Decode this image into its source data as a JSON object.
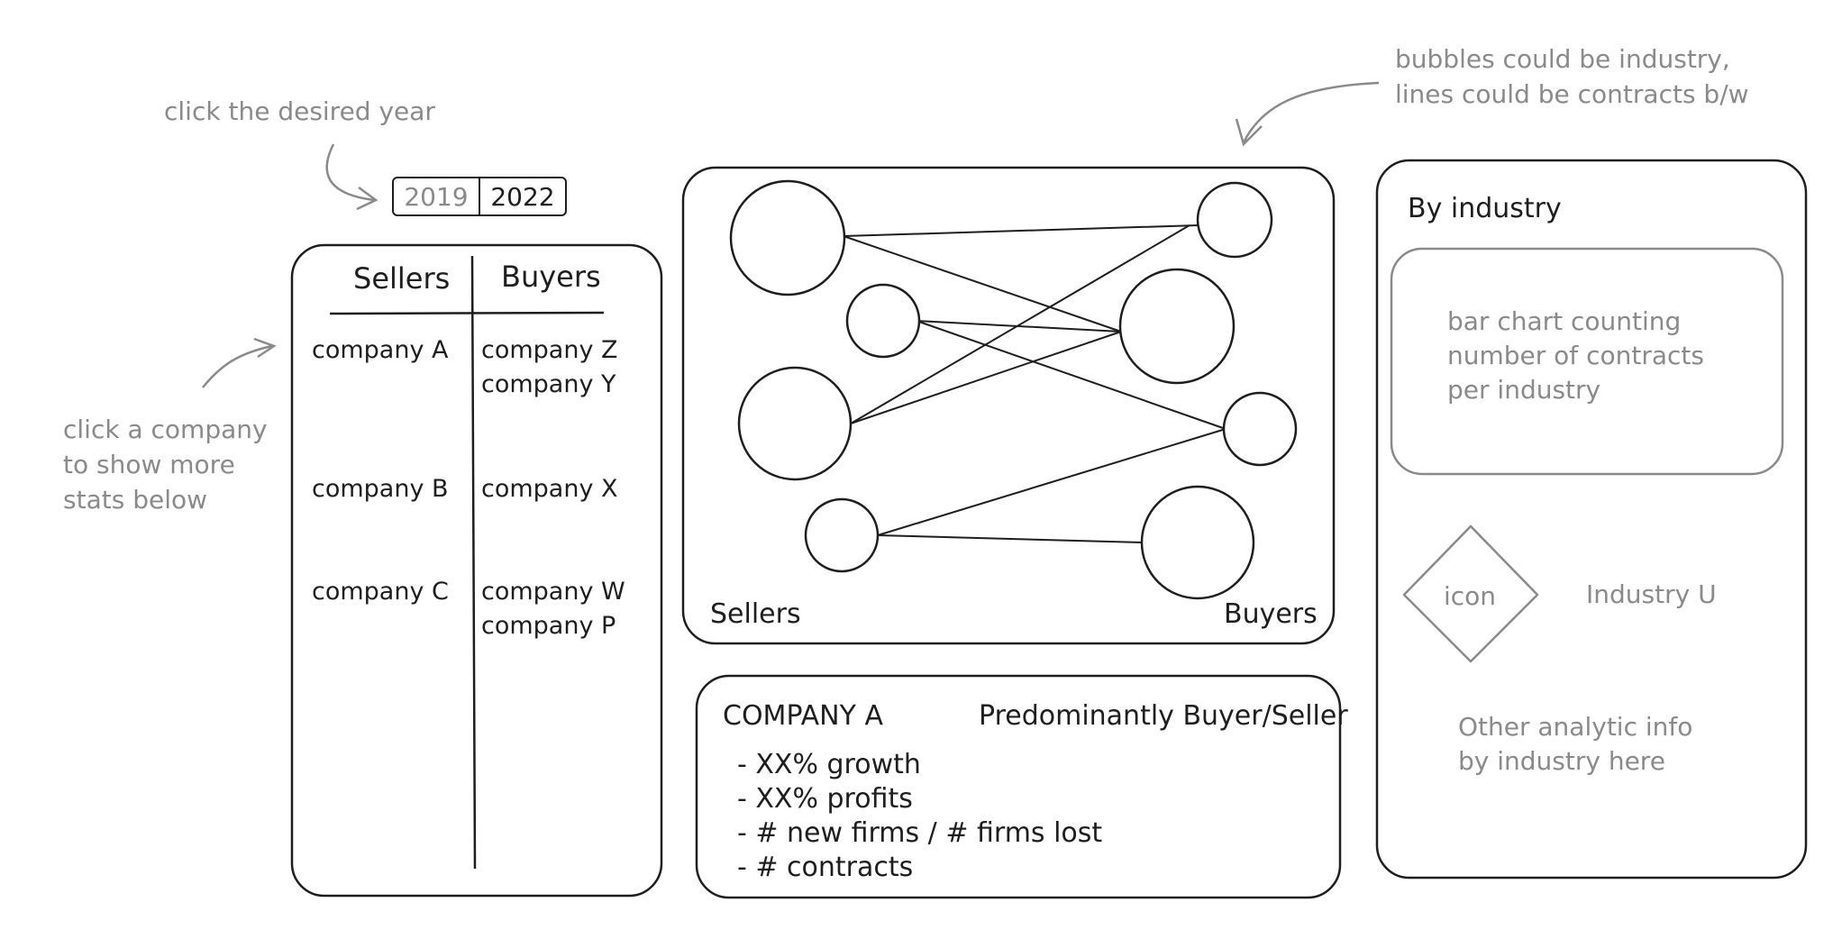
{
  "annotations": {
    "year_hint": "click the desired year",
    "bubble_hint": [
      "bubbles could be industry,",
      "lines could be contracts b/w"
    ],
    "company_hint": [
      "click a company",
      "to show more",
      "stats below"
    ]
  },
  "year_toggle": {
    "options": [
      "2019",
      "2022"
    ],
    "selected": "2022"
  },
  "table": {
    "headers": {
      "sellers": "Sellers",
      "buyers": "Buyers"
    },
    "rows": [
      {
        "seller": "company A",
        "buyers": [
          "company Z",
          "company Y"
        ]
      },
      {
        "seller": "company B",
        "buyers": [
          "company X"
        ]
      },
      {
        "seller": "company C",
        "buyers": [
          "company W",
          "company P"
        ]
      }
    ]
  },
  "network": {
    "left_label": "Sellers",
    "right_label": "Buyers"
  },
  "detail": {
    "company": "COMPANY A",
    "role": "Predominantly Buyer/Seller",
    "stats": [
      "- XX% growth",
      "- XX% profits",
      "- # new firms / # firms lost",
      "- # contracts"
    ]
  },
  "industry": {
    "title": "By industry",
    "chart_placeholder": [
      "bar chart counting",
      "number of contracts",
      "per industry"
    ],
    "icon_label": "icon",
    "industry_name": "Industry U",
    "other_info": [
      "Other analytic info",
      "by industry here"
    ]
  },
  "colors": {
    "ink": "#1e1e1e",
    "note": "#8a8a8a",
    "background": "#ffffff"
  }
}
